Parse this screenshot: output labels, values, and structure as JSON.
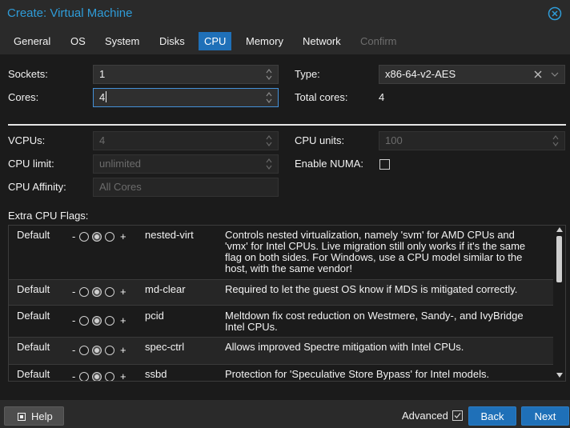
{
  "window": {
    "title": "Create: Virtual Machine"
  },
  "tabs": [
    {
      "label": "General"
    },
    {
      "label": "OS"
    },
    {
      "label": "System"
    },
    {
      "label": "Disks"
    },
    {
      "label": "CPU"
    },
    {
      "label": "Memory"
    },
    {
      "label": "Network"
    },
    {
      "label": "Confirm"
    }
  ],
  "cpu": {
    "sockets_label": "Sockets:",
    "sockets_value": "1",
    "cores_label": "Cores:",
    "cores_value": "4",
    "type_label": "Type:",
    "type_value": "x86-64-v2-AES",
    "total_cores_label": "Total cores:",
    "total_cores_value": "4"
  },
  "advanced": {
    "vcpus_label": "VCPUs:",
    "vcpus_value": "4",
    "cpu_units_label": "CPU units:",
    "cpu_units_value": "100",
    "cpu_limit_label": "CPU limit:",
    "cpu_limit_value": "unlimited",
    "enable_numa_label": "Enable NUMA:",
    "cpu_affinity_label": "CPU Affinity:",
    "cpu_affinity_placeholder": "All Cores"
  },
  "flags": {
    "label": "Extra CPU Flags:",
    "minus": "-",
    "plus": "+",
    "rows": [
      {
        "state": "Default",
        "name": "nested-virt",
        "description": "Controls nested virtualization, namely 'svm' for AMD CPUs and 'vmx' for Intel CPUs. Live migration still only works if it's the same flag on both sides. For Windows, use a CPU model similar to the host, with the same vendor!"
      },
      {
        "state": "Default",
        "name": "md-clear",
        "description": "Required to let the guest OS know if MDS is mitigated correctly."
      },
      {
        "state": "Default",
        "name": "pcid",
        "description": "Meltdown fix cost reduction on Westmere, Sandy-, and IvyBridge Intel CPUs."
      },
      {
        "state": "Default",
        "name": "spec-ctrl",
        "description": "Allows improved Spectre mitigation with Intel CPUs."
      },
      {
        "state": "Default",
        "name": "ssbd",
        "description": "Protection for 'Speculative Store Bypass' for Intel models."
      }
    ]
  },
  "footer": {
    "help_label": "Help",
    "advanced_label": "Advanced",
    "back_label": "Back",
    "next_label": "Next"
  },
  "colors": {
    "accent": "#1f70b8",
    "title": "#2f9cd8",
    "background": "#1b1b1b",
    "panel": "#2a2a2a"
  }
}
